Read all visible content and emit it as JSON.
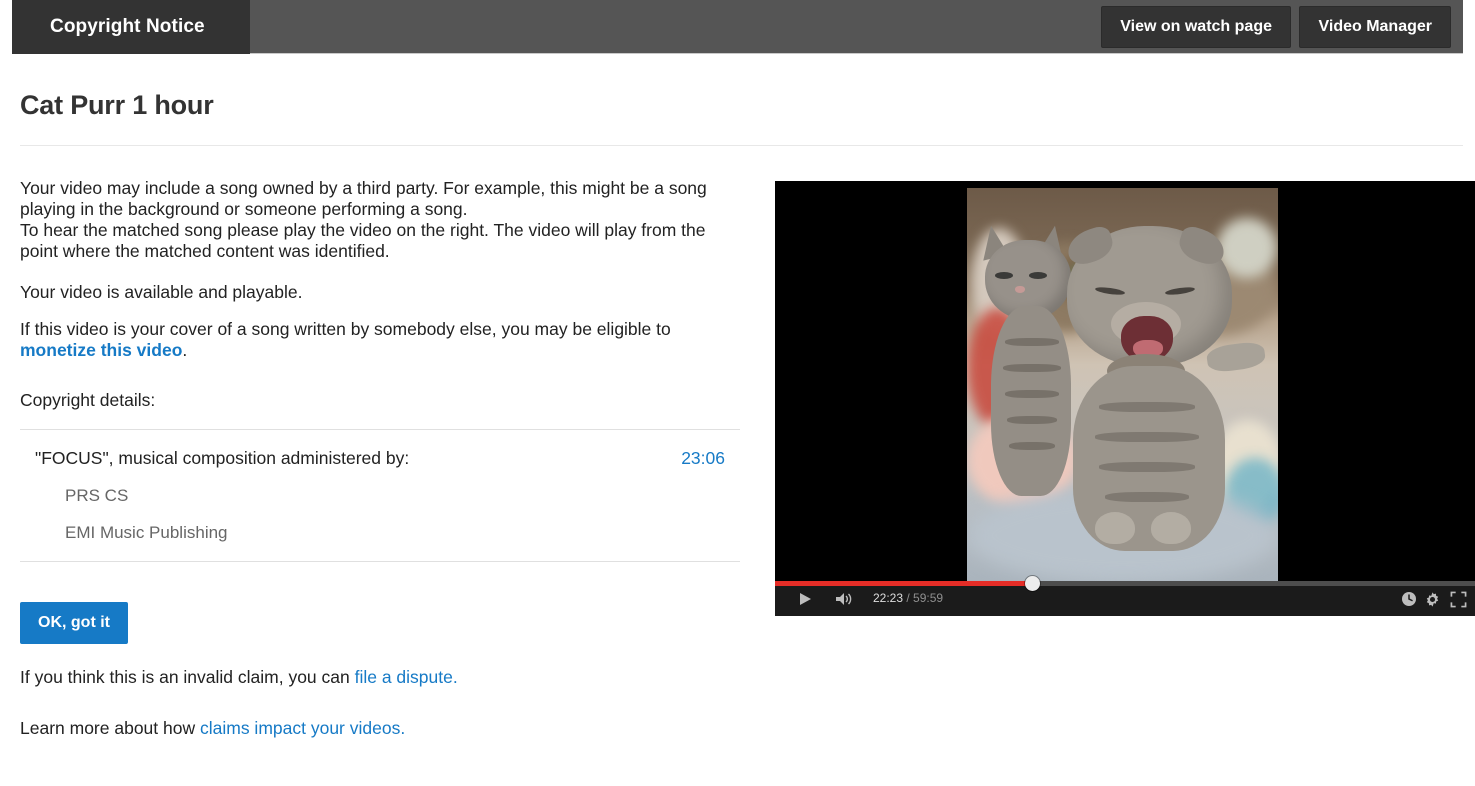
{
  "header": {
    "tab_label": "Copyright Notice",
    "buttons": [
      {
        "label": "View on watch page",
        "name": "view-on-watch-page-button"
      },
      {
        "label": "Video Manager",
        "name": "video-manager-button"
      }
    ]
  },
  "page_title": "Cat Purr 1 hour",
  "body": {
    "intro_line1": "Your video may include a song owned by a third party. For example, this might be a song playing in the background or someone performing a song.",
    "intro_line2": "To hear the matched song please play the video on the right. The video will play from the point where the matched content was identified.",
    "available_status": "Your video is available and playable.",
    "cover_prefix": "If this video is your cover of a song written by somebody else, you may be eligible to ",
    "cover_link": "monetize this video",
    "cover_suffix": ".",
    "copyright_details_label": "Copyright details:"
  },
  "copyright_details": {
    "title": "\"FOCUS\", musical composition administered by:",
    "timestamp": "23:06",
    "administrators": [
      "PRS CS",
      "EMI Music Publishing"
    ]
  },
  "footer": {
    "ok_button": "OK, got it",
    "dispute_prefix": "If you think this is an invalid claim, you can ",
    "dispute_link": "file a dispute.",
    "learn_prefix": "Learn more about how ",
    "learn_link": "claims impact your videos."
  },
  "player": {
    "current_time": "22:23",
    "total_time": " / 59:59",
    "progress_percent": 37,
    "controls": {
      "play": "play-icon",
      "volume": "volume-icon",
      "watch_later": "watch-later-icon",
      "settings": "settings-gear-icon",
      "fullscreen": "fullscreen-icon"
    }
  },
  "colors": {
    "header_bar": "#555555",
    "header_tab": "#333333",
    "link_blue": "#167ac6",
    "button_blue": "#167ac6",
    "progress_red": "#e52d27",
    "player_bg": "#000000"
  }
}
